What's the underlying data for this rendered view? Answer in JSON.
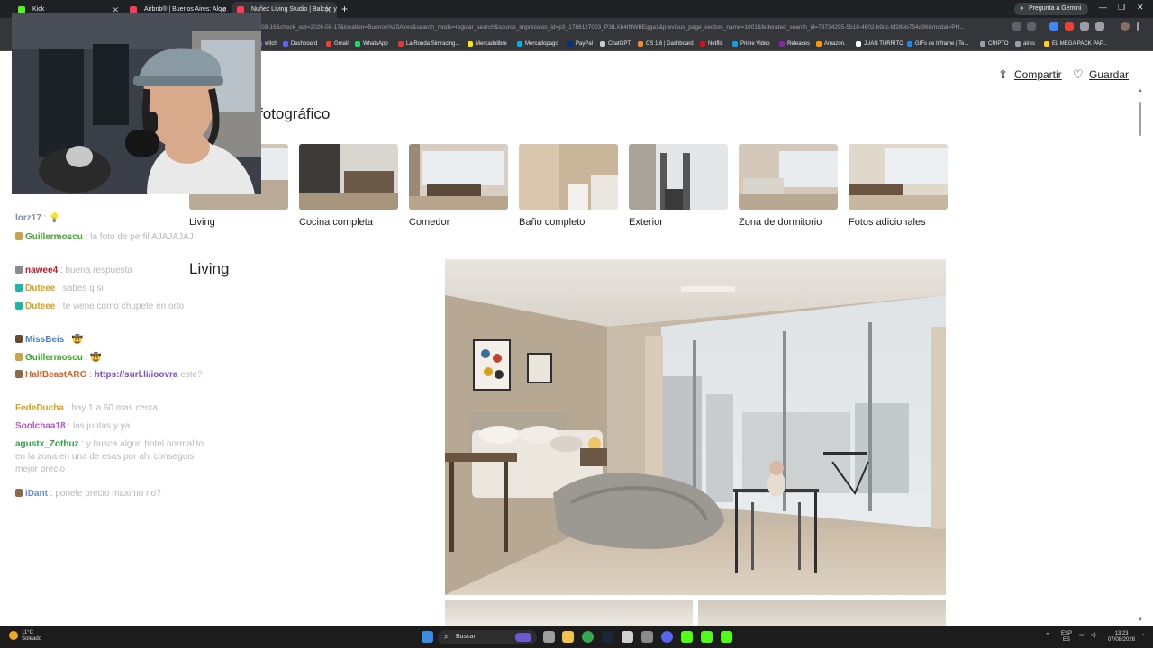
{
  "browser": {
    "tabs": [
      {
        "label": "Kick",
        "color": "#53fc18"
      },
      {
        "label": "Airbnb® | Buenos Aires: Aloja",
        "color": "#ff385c"
      },
      {
        "label": "Nuñez Living Studio | Balcón y",
        "color": "#ff385c"
      }
    ],
    "gemini_label": "Pregunta a Gemini",
    "url": "08-16&check_out=2026-08-17&location=Buenos%20Aires&search_mode=regular_search&source_impression_id=p3_1786127003_P3fLXb4INWBEqga1&previous_page_section_name=1001&federated_search_id=79724295-5b18-4602-b9dc-bf28eb754a96&modal=PH..."
  },
  "bookmarks": [
    {
      "label": "witch",
      "color": "#9146ff"
    },
    {
      "label": "Dashboard",
      "color": "#5865f2"
    },
    {
      "label": "Gmail",
      "color": "#ea4335"
    },
    {
      "label": "WhatsApp",
      "color": "#25d366"
    },
    {
      "label": "La Ronda Simracing...",
      "color": "#e53935"
    },
    {
      "label": "Mercadolibre",
      "color": "#ffe600"
    },
    {
      "label": "Mercadopago",
      "color": "#00b1ea"
    },
    {
      "label": "PayPal",
      "color": "#003087"
    },
    {
      "label": "ChatGPT",
      "color": "#cccccc"
    },
    {
      "label": "CS 1.6 | Dashboard",
      "color": "#f08a24"
    },
    {
      "label": "Netflix",
      "color": "#e50914"
    },
    {
      "label": "Prime Video",
      "color": "#00a8e1"
    },
    {
      "label": "Releases",
      "color": "#8e24aa"
    },
    {
      "label": "Amazon.",
      "color": "#ff9900"
    },
    {
      "label": "JUAN TURRITO",
      "color": "#ffffff"
    },
    {
      "label": "GIFs de Inframe | Te...",
      "color": "#1e88e5"
    },
    {
      "label": "CRIPTO",
      "color": "#9aa0a6"
    },
    {
      "label": "aires",
      "color": "#9aa0a6"
    },
    {
      "label": "EL MEGA PACK PAP...",
      "color": "#ffd600"
    }
  ],
  "header": {
    "share_label": "Compartir",
    "save_label": "Guardar"
  },
  "tour": {
    "title": "fotográfico",
    "thumbnails": [
      {
        "label": "Living"
      },
      {
        "label": "Cocina completa"
      },
      {
        "label": "Comedor"
      },
      {
        "label": "Baño completo"
      },
      {
        "label": "Exterior"
      },
      {
        "label": "Zona de dormitorio"
      },
      {
        "label": "Fotos adicionales"
      }
    ]
  },
  "section": {
    "title": "Living"
  },
  "chat": {
    "messages": [
      {
        "user": "lorz17",
        "user_color": "#7d8fb0",
        "text": "💡",
        "badge": ""
      },
      {
        "user": "Guillermoscu",
        "user_color": "#3fa52b",
        "text": "la foto de perfil AJAJAJAJ",
        "badge": "#c9a24a"
      },
      {
        "user": "nawee4",
        "user_color": "#c0182b",
        "text": "buena respuesta",
        "badge": "#8a8a8a"
      },
      {
        "user": "Duteee",
        "user_color": "#d4a017",
        "text": "sabes q si",
        "badge": "#1fb5a6"
      },
      {
        "user": "Duteee",
        "user_color": "#d4a017",
        "text": "te viene como chupete en orto",
        "badge": "#1fb5a6"
      },
      {
        "user": "MissBeis",
        "user_color": "#4a7fd4",
        "text": "🤠",
        "badge": "#6b4a2b"
      },
      {
        "user": "Guillermoscu",
        "user_color": "#3fa52b",
        "text": "🤠",
        "badge": "#c9a24a"
      },
      {
        "user": "HalfBeastARG",
        "user_color": "#d4622a",
        "text": "este?",
        "link": "https://surl.li/ioovra",
        "badge": "#8a6a4a"
      },
      {
        "user": "FedeDucha",
        "user_color": "#d4a017",
        "text": "hay 1 a 60 mas cerca",
        "badge": ""
      },
      {
        "user": "Soolchaa18",
        "user_color": "#b84fcf",
        "text": "las juntas y ya",
        "badge": ""
      },
      {
        "user": "agustx_Zothuz",
        "user_color": "#2f9e44",
        "text": "y busca algun hotel normalito en la zona en una de esas por ahi conseguis mejor precio",
        "badge": ""
      },
      {
        "user": "iDant",
        "user_color": "#6c8ad4",
        "text": "ponele precio maximo no?",
        "badge": "#8a6a4a"
      }
    ]
  },
  "taskbar": {
    "weather_temp": "11°C",
    "weather_desc": "Soleado",
    "search_placeholder": "Buscar",
    "lang_top": "ESP",
    "lang_bottom": "ES",
    "time": "13:23",
    "date": "07/08/2026"
  }
}
